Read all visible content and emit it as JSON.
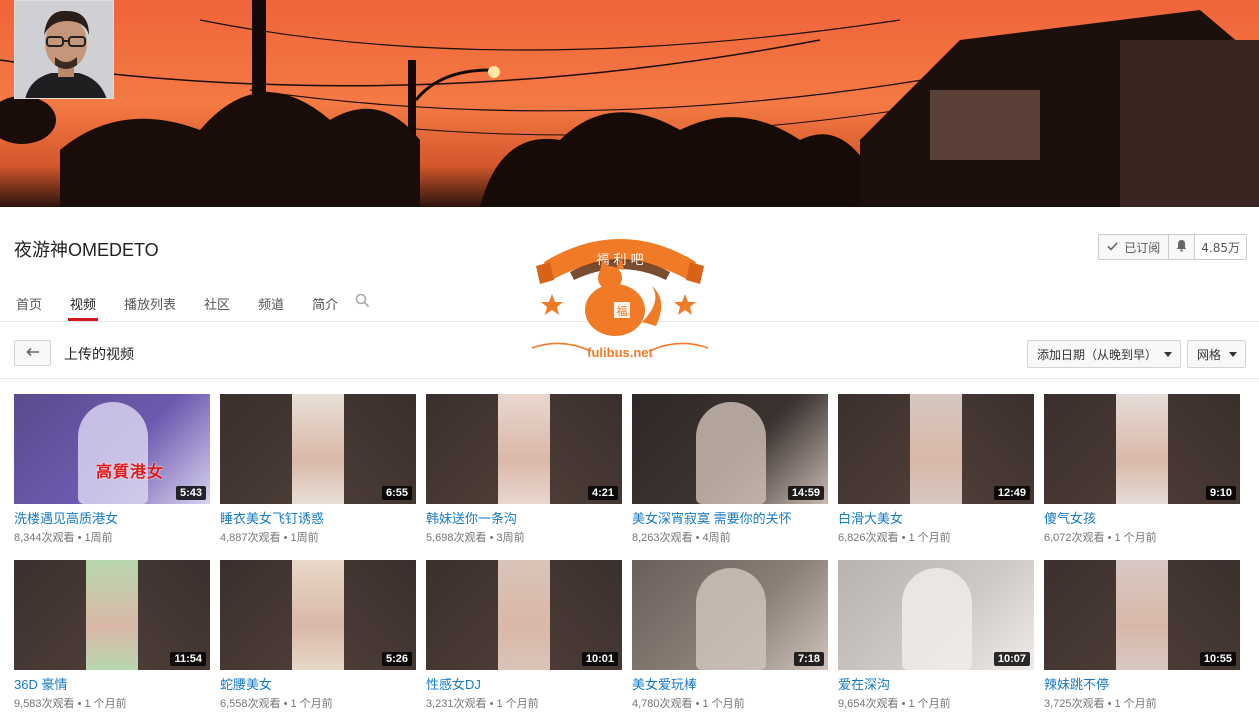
{
  "channel": {
    "name": "夜游神OMEDETO",
    "subscribed_label": "已订阅",
    "subscriber_count": "4.85万"
  },
  "tabs": [
    {
      "label": "首页"
    },
    {
      "label": "视频"
    },
    {
      "label": "播放列表"
    },
    {
      "label": "社区"
    },
    {
      "label": "频道"
    },
    {
      "label": "简介"
    }
  ],
  "active_tab": "视频",
  "section": {
    "title": "上传的视频",
    "sort_label": "添加日期（从晚到早）",
    "view_label": "网格"
  },
  "watermark": {
    "ribbon_text": "福 利 吧",
    "badge_char": "福",
    "site": "fulibus.net"
  },
  "colors": {
    "accent": "#cc181e",
    "link": "#167ac6",
    "meta": "#767676",
    "watermark": "#f07a26"
  },
  "videos": [
    {
      "title": "洗楼遇见高质港女",
      "duration": "5:43",
      "meta": "8,344次观看 • 1周前",
      "overlay": "高質港女"
    },
    {
      "title": "睡衣美女飞钉诱惑",
      "duration": "6:55",
      "meta": "4,887次观看 • 1周前"
    },
    {
      "title": "韩妹送你一条沟",
      "duration": "4:21",
      "meta": "5,698次观看 • 3周前"
    },
    {
      "title": "美女深宵寂寞 需要你的关怀",
      "duration": "14:59",
      "meta": "8,263次观看 • 4周前"
    },
    {
      "title": "白滑大美女",
      "duration": "12:49",
      "meta": "6,826次观看 • 1 个月前"
    },
    {
      "title": "傻气女孩",
      "duration": "9:10",
      "meta": "6,072次观看 • 1 个月前"
    },
    {
      "title": "36D 豪情",
      "duration": "11:54",
      "meta": "9,583次观看 • 1 个月前"
    },
    {
      "title": "蛇腰美女",
      "duration": "5:26",
      "meta": "6,558次观看 • 1 个月前"
    },
    {
      "title": "性感女DJ",
      "duration": "10:01",
      "meta": "3,231次观看 • 1 个月前"
    },
    {
      "title": "美女爱玩棒",
      "duration": "7:18",
      "meta": "4,780次观看 • 1 个月前"
    },
    {
      "title": "爱在深沟",
      "duration": "10:07",
      "meta": "9,654次观看 • 1 个月前"
    },
    {
      "title": "辣妹跳不停",
      "duration": "10:55",
      "meta": "3,725次观看 • 1 个月前"
    }
  ]
}
